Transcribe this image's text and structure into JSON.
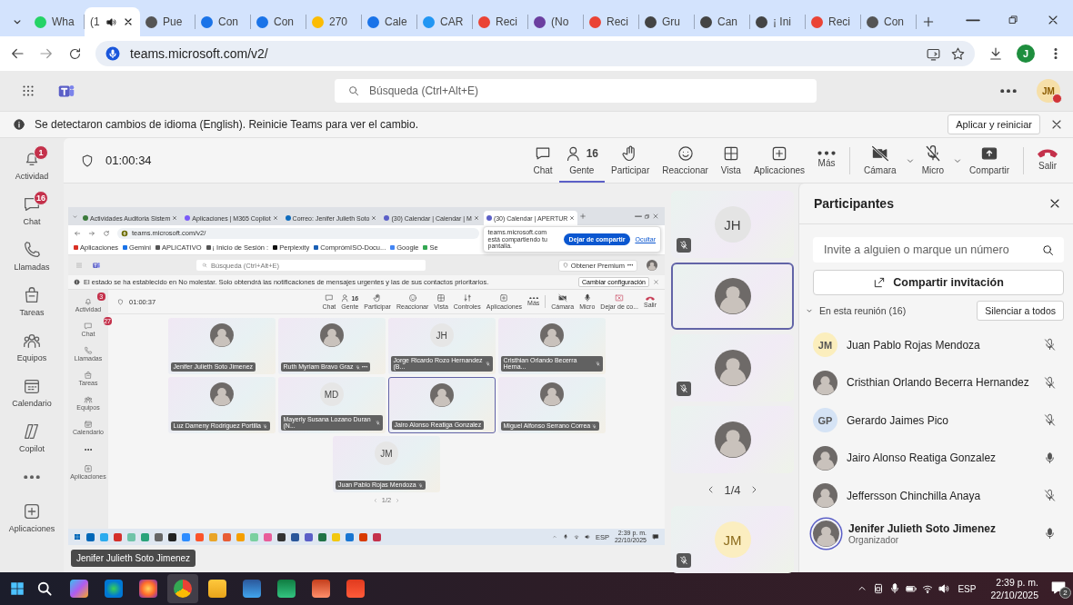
{
  "browser": {
    "tabs": [
      {
        "label": "Wha",
        "selected": false
      },
      {
        "label": "(1",
        "selected": true
      },
      {
        "label": "Pue",
        "selected": false
      },
      {
        "label": "Con",
        "selected": false
      },
      {
        "label": "Con",
        "selected": false
      },
      {
        "label": "270",
        "selected": false
      },
      {
        "label": "Cale",
        "selected": false
      },
      {
        "label": "CAR",
        "selected": false
      },
      {
        "label": "Reci",
        "selected": false
      },
      {
        "label": "(No",
        "selected": false
      },
      {
        "label": "Reci",
        "selected": false
      },
      {
        "label": "Gru",
        "selected": false
      },
      {
        "label": "Can",
        "selected": false
      },
      {
        "label": "¡ Ini",
        "selected": false
      },
      {
        "label": "Reci",
        "selected": false
      },
      {
        "label": "Con",
        "selected": false
      }
    ],
    "address": "teams.microsoft.com/v2/",
    "profile": "J"
  },
  "teams_header": {
    "search": {
      "placeholder": "Búsqueda (Ctrl+Alt+E)"
    },
    "avatar": {
      "initials": "JM",
      "color": "#d13438"
    }
  },
  "banner": {
    "message": "Se detectaron cambios de idioma (English). Reinicie Teams para ver el cambio.",
    "button": "Aplicar y reiniciar"
  },
  "rail": [
    {
      "label": "Actividad",
      "badge": "1"
    },
    {
      "label": "Chat",
      "badge": "16"
    },
    {
      "label": "Llamadas"
    },
    {
      "label": "Tareas"
    },
    {
      "label": "Equipos"
    },
    {
      "label": "Calendario"
    },
    {
      "label": "Copilot"
    },
    {
      "label": "Aplicaciones"
    }
  ],
  "call_toolbar": {
    "timer": "01:00:34",
    "buttons": [
      {
        "label": "Chat",
        "selected": false
      },
      {
        "label": "Gente",
        "count": "16",
        "selected": true
      },
      {
        "label": "Participar",
        "selected": false
      },
      {
        "label": "Reaccionar",
        "selected": false
      },
      {
        "label": "Vista",
        "selected": false
      },
      {
        "label": "Aplicaciones",
        "selected": false
      },
      {
        "label": "Más",
        "selected": false
      }
    ],
    "camera": {
      "label": "Cámara",
      "on": false
    },
    "mic": {
      "label": "Micro",
      "on": false
    },
    "share": {
      "label": "Compartir"
    },
    "leave": {
      "label": "Salir"
    }
  },
  "shared_screen": {
    "browser_tabs": [
      {
        "label": "Actividades Auditoria Sistem",
        "selected": false
      },
      {
        "label": "Aplicaciones | M365 Copilot",
        "selected": false
      },
      {
        "label": "Correo: Jenifer Julieth Soto",
        "selected": false
      },
      {
        "label": "(30) Calendar | Calendar | M",
        "selected": false
      },
      {
        "label": "(30) Calendar | APERTUR",
        "selected": true
      }
    ],
    "address": "teams.microsoft.com/v2/",
    "share_notice": {
      "text": "teams.microsoft.com está compartiendo tu pantalla.",
      "stop_button": "Dejar de compartir",
      "hide_link": "Ocultar"
    },
    "bookmarks": [
      "Aplicaciones",
      "Gemini",
      "APLICATIVO",
      "¡ Inicio de Sesión :",
      "Perplexity",
      "ComprómISO-Docu...",
      "Google",
      "Se"
    ],
    "search": {
      "placeholder": "Búsqueda (Ctrl+Alt+E)"
    },
    "premium_button": "Obtener Premium",
    "banner": {
      "message": "El estado se ha establecido en No molestar. Solo obtendrá las notificaciones de mensajes urgentes y las de sus contactos prioritarios.",
      "button": "Cambiar configuración"
    },
    "rail": [
      {
        "label": "Actividad",
        "badge": "3"
      },
      {
        "label": "Chat",
        "badge": "27"
      },
      {
        "label": "Llamadas"
      },
      {
        "label": "Tareas"
      },
      {
        "label": "Equipos"
      },
      {
        "label": "Calendario"
      },
      {
        "label": "Aplicaciones"
      }
    ],
    "timer": "01:00:37",
    "toolbar": [
      {
        "label": "Chat"
      },
      {
        "label": "Gente",
        "count": "16"
      },
      {
        "label": "Participar"
      },
      {
        "label": "Reaccionar"
      },
      {
        "label": "Vista"
      },
      {
        "label": "Controles"
      },
      {
        "label": "Aplicaciones"
      },
      {
        "label": "Más"
      },
      {
        "label": "Cámara"
      },
      {
        "label": "Micro"
      },
      {
        "label": "Dejar de co..."
      },
      {
        "label": "Salir"
      }
    ],
    "tiles": [
      {
        "name": "Jenifer Julieth Soto Jimenez",
        "muted": false,
        "speaking": false,
        "more": false
      },
      {
        "name": "Ruth Myriam Bravo Graz",
        "muted": true,
        "speaking": false,
        "more": true
      },
      {
        "name": "Jorge Ricardo Rozo Hernandez (B...",
        "initials": "JH",
        "muted": true,
        "speaking": false,
        "more": false
      },
      {
        "name": "Cristhian Orlando Becerra Herna...",
        "muted": true,
        "speaking": false,
        "more": false
      },
      {
        "name": "Luz Dameny Rodriguez Portilla",
        "muted": true,
        "speaking": false,
        "more": false
      },
      {
        "name": "Mayerly Susana Lozano Duran (N...",
        "initials": "MD",
        "muted": true,
        "speaking": false,
        "more": false
      },
      {
        "name": "Jairo Alonso Reatiga Gonzalez",
        "muted": false,
        "speaking": true,
        "more": false
      },
      {
        "name": "Miguel Alfonso Serrano Correa",
        "muted": true,
        "speaking": false,
        "more": false
      },
      {
        "name": "Juan Pablo Rojas Mendoza",
        "initials": "JM",
        "muted": true,
        "speaking": false,
        "more": false
      }
    ],
    "pager": "1/2",
    "taskbar": {
      "language": "ESP",
      "time": "2:39 p. m.",
      "date": "22/10/2025"
    },
    "tooltip": "Jenifer Julieth Soto Jimenez"
  },
  "film_strip": {
    "tiles": [
      {
        "initials": "JH",
        "muted": true,
        "speaking": false
      },
      {
        "muted": false,
        "speaking": true
      },
      {
        "muted": true,
        "speaking": false
      },
      {
        "muted": false,
        "speaking": false
      }
    ],
    "pager": "1/4",
    "tiles_below": [
      {
        "initials": "JM",
        "muted": true,
        "speaking": false
      }
    ]
  },
  "participants": {
    "title": "Participantes",
    "invite": {
      "placeholder": "Invite a alguien o marque un número"
    },
    "share_button": "Compartir invitación",
    "section": {
      "label": "En esta reunión (16)",
      "expanded": true,
      "mute_all": "Silenciar a todos"
    },
    "people": [
      {
        "name": "Juan Pablo Rojas Mendoza",
        "initials": "JM",
        "color": "#fbeebd",
        "muted": true,
        "speaking": false
      },
      {
        "name": "Cristhian Orlando Becerra Hernandez",
        "muted": true,
        "speaking": false
      },
      {
        "name": "Gerardo Jaimes Pico",
        "initials": "GP",
        "color": "#d5e3f5",
        "muted": true,
        "speaking": false
      },
      {
        "name": "Jairo Alonso Reatiga Gonzalez",
        "muted": false,
        "speaking": false
      },
      {
        "name": "Jeffersson Chinchilla Anaya",
        "muted": true,
        "speaking": false
      },
      {
        "name": "Jenifer Julieth Soto Jimenez",
        "role": "Organizador",
        "muted": false,
        "speaking": true
      }
    ]
  },
  "taskbar": {
    "apps": [
      {
        "selected": false
      },
      {
        "selected": false
      },
      {
        "selected": false
      },
      {
        "selected": true
      },
      {
        "selected": false
      },
      {
        "selected": false
      },
      {
        "selected": false
      },
      {
        "selected": false
      },
      {
        "selected": false
      }
    ],
    "language": "ESP",
    "time": "2:39 p. m.",
    "date": "22/10/2025",
    "notifications": "2"
  }
}
